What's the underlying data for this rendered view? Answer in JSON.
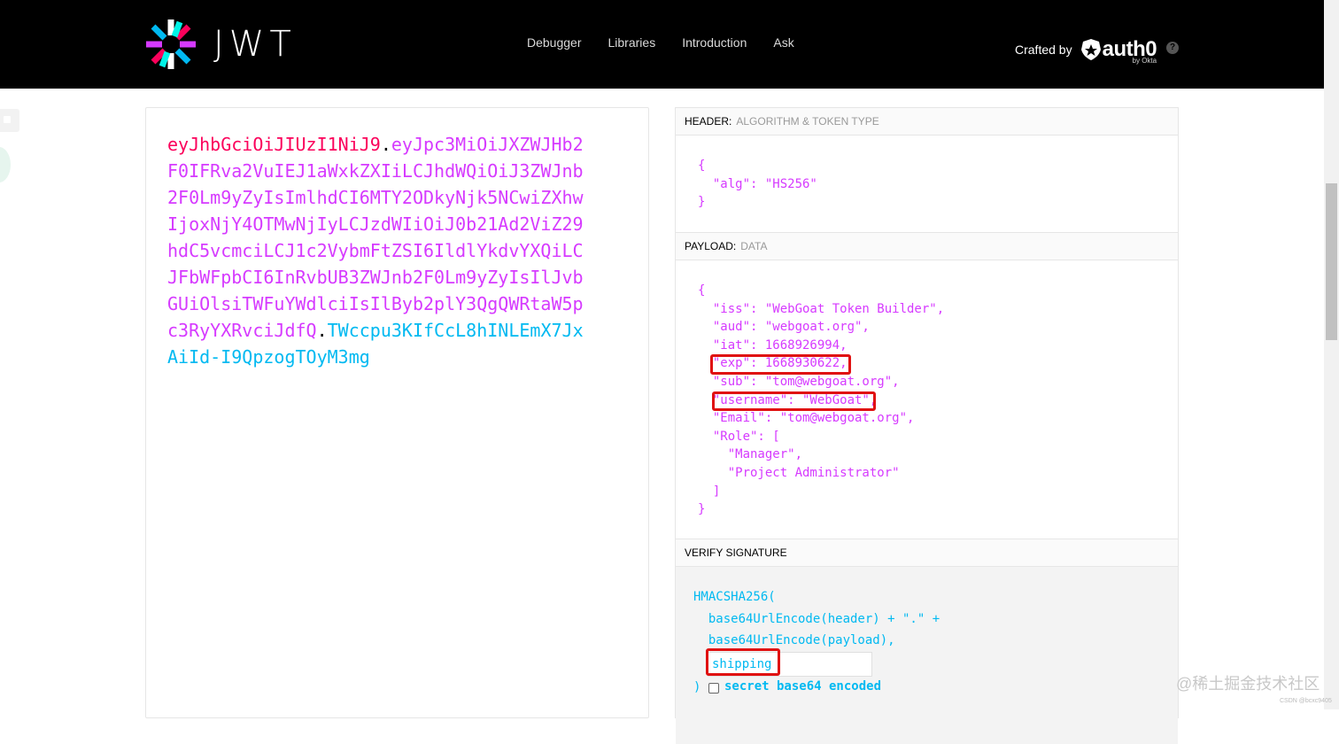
{
  "header": {
    "logo_text": "JWT",
    "nav": [
      "Debugger",
      "Libraries",
      "Introduction",
      "Ask"
    ],
    "crafted_by": "Crafted by",
    "auth0_word": "auth0",
    "by_okta": "by Okta",
    "help": "?"
  },
  "encoded": {
    "header_part": "eyJhbGciOiJIUzI1NiJ9",
    "dot1": ".",
    "payload_part": "eyJpc3MiOiJXZWJHb2F0IFRva2VuIEJ1aWxkZXIiLCJhdWQiOiJ3ZWJnb2F0Lm9yZyIsImlhdCI6MTY2ODkyNjk5NCwiZXhwIjoxNjY4OTMwNjIyLCJzdWIiOiJ0b21Ad2ViZ29hdC5vcmciLCJ1c2VybmFtZSI6IldlYkdvYXQiLCJFbWFpbCI6InRvbUB3ZWJnb2F0Lm9yZyIsIlJvbGUiOlsiTWFuYWdlciIsIlByb2plY3QgQWRtaW5pc3RyYXRvciJdfQ",
    "dot2": ".",
    "signature_part": "TWccpu3KIfCcL8hINLEmX7JxAiId-I9QpzogTOyM3mg"
  },
  "decoded": {
    "header_title": "HEADER:",
    "header_sub": "ALGORITHM & TOKEN TYPE",
    "header_json": "{\n  \"alg\": \"HS256\"\n}",
    "payload_title": "PAYLOAD:",
    "payload_sub": "DATA",
    "payload_json": "{\n  \"iss\": \"WebGoat Token Builder\",\n  \"aud\": \"webgoat.org\",\n  \"iat\": 1668926994,\n  \"exp\": 1668930622,\n  \"sub\": \"tom@webgoat.org\",\n  \"username\": \"WebGoat\",\n  \"Email\": \"tom@webgoat.org\",\n  \"Role\": [\n    \"Manager\",\n    \"Project Administrator\"\n  ]\n}",
    "verify_title": "VERIFY SIGNATURE",
    "verify_line1": "HMACSHA256(",
    "verify_line2": "  base64UrlEncode(header) + \".\" +",
    "verify_line3": "  base64UrlEncode(payload),",
    "secret_value": "shipping",
    "verify_close": ")",
    "secret_checkbox_label": "secret base64 encoded",
    "secret_checked": false
  },
  "watermark": "@稀土掘金技术社区",
  "watermark_small": "CSDN @bcxc9405",
  "colors": {
    "header_part": "#fb015b",
    "payload_part": "#d63aff",
    "signature_part": "#00b9f1",
    "highlight": "#e01010"
  }
}
